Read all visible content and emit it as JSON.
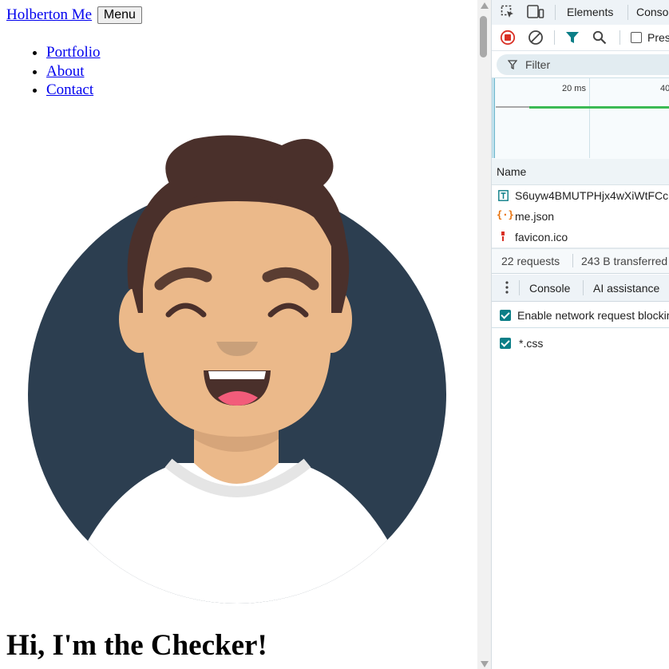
{
  "page": {
    "brand": "Holberton Me",
    "menu_button": "Menu",
    "nav": [
      "Portfolio",
      "About",
      "Contact"
    ],
    "hero_title": "Hi, I'm the Checker!"
  },
  "devtools": {
    "tabs": {
      "elements": "Elements",
      "console": "Conso"
    },
    "toolbar": {
      "preserve_log": "Pres"
    },
    "filter_placeholder": "Filter",
    "timeline_ticks": [
      "20 ms",
      "40"
    ],
    "name_column": "Name",
    "requests": [
      {
        "name": "S6uyw4BMUTPHjx4wXiWtFCc",
        "icon": "document-icon"
      },
      {
        "name": "me.json",
        "icon": "json-icon"
      },
      {
        "name": "favicon.ico",
        "icon": "image-icon"
      }
    ],
    "summary": {
      "requests": "22 requests",
      "transferred": "243 B transferred"
    },
    "drawer": {
      "console_tab": "Console",
      "ai_tab": "AI assistance",
      "enable_blocking": "Enable network request blocking",
      "pattern": "*.css"
    }
  },
  "colors": {
    "link": "#0000ee",
    "avatar_bg": "#2c3e50",
    "skin": "#ebb98a",
    "hair": "#4a302b",
    "accent_teal": "#0b7e87",
    "record_red": "#d93025"
  }
}
